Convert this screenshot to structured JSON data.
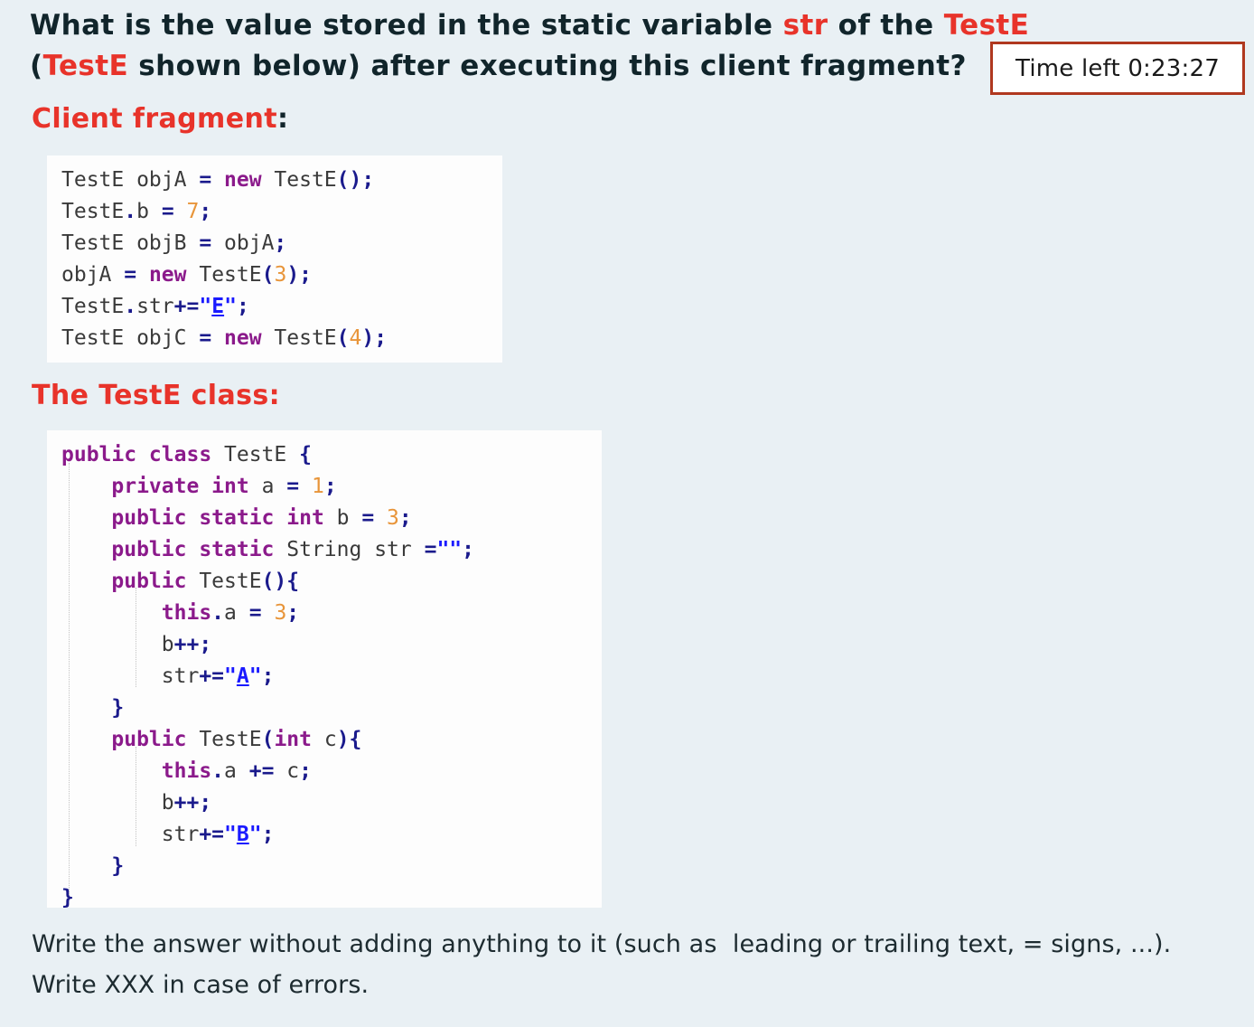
{
  "question": {
    "segments": [
      {
        "text": "What is the value stored in the static variable ",
        "accent": false
      },
      {
        "text": "str",
        "accent": true
      },
      {
        "text": " of the ",
        "accent": false
      },
      {
        "text": "TestE",
        "accent": true
      },
      {
        "text": " (",
        "accent": false
      },
      {
        "text": "TestE",
        "accent": true
      },
      {
        "text": " shown below) after executing this client fragment?",
        "accent": false
      }
    ],
    "plain_text": "What is the value stored in the static variable str of the TestE (TestE shown below) after executing this client fragment?"
  },
  "timer": {
    "label": "Time left 0:23:27",
    "border_color": "#b0381f",
    "background": "#ffffff"
  },
  "headings": {
    "client_fragment": "Client fragment",
    "client_fragment_punct": ":",
    "teste_class": "The TestE class:"
  },
  "colors": {
    "page_background": "#e9f0f4",
    "accent_red": "#e8332a",
    "question_text": "#11252b",
    "code_background": "#fdfdfd",
    "keyword": "#8b1a8b",
    "number": "#e8953a",
    "operator": "#1a1a8c",
    "string": "#1a1aff",
    "identifier": "#3a3a3a"
  },
  "client_code": {
    "lines": [
      [
        {
          "t": "TestE objA ",
          "c": "t-type"
        },
        {
          "t": "= ",
          "c": "t-op"
        },
        {
          "t": "new ",
          "c": "t-kw"
        },
        {
          "t": "TestE",
          "c": "t-type"
        },
        {
          "t": "();",
          "c": "t-op"
        }
      ],
      [
        {
          "t": "TestE",
          "c": "t-type"
        },
        {
          "t": ".",
          "c": "t-op"
        },
        {
          "t": "b ",
          "c": "t-id"
        },
        {
          "t": "= ",
          "c": "t-op"
        },
        {
          "t": "7",
          "c": "t-num"
        },
        {
          "t": ";",
          "c": "t-op"
        }
      ],
      [
        {
          "t": "TestE objB ",
          "c": "t-type"
        },
        {
          "t": "= ",
          "c": "t-op"
        },
        {
          "t": "objA",
          "c": "t-id"
        },
        {
          "t": ";",
          "c": "t-op"
        }
      ],
      [
        {
          "t": "objA ",
          "c": "t-id"
        },
        {
          "t": "= ",
          "c": "t-op"
        },
        {
          "t": "new ",
          "c": "t-kw"
        },
        {
          "t": "TestE",
          "c": "t-type"
        },
        {
          "t": "(",
          "c": "t-op"
        },
        {
          "t": "3",
          "c": "t-num"
        },
        {
          "t": ");",
          "c": "t-op"
        }
      ],
      [
        {
          "t": "TestE",
          "c": "t-type"
        },
        {
          "t": ".",
          "c": "t-op"
        },
        {
          "t": "str",
          "c": "t-id"
        },
        {
          "t": "+=",
          "c": "t-op"
        },
        {
          "t": "\"",
          "c": "t-quote"
        },
        {
          "t": "E",
          "c": "t-str"
        },
        {
          "t": "\"",
          "c": "t-quote"
        },
        {
          "t": ";",
          "c": "t-op"
        }
      ],
      [
        {
          "t": "TestE objC ",
          "c": "t-type"
        },
        {
          "t": "= ",
          "c": "t-op"
        },
        {
          "t": "new ",
          "c": "t-kw"
        },
        {
          "t": "TestE",
          "c": "t-type"
        },
        {
          "t": "(",
          "c": "t-op"
        },
        {
          "t": "4",
          "c": "t-num"
        },
        {
          "t": ");",
          "c": "t-op"
        }
      ]
    ],
    "plain_text": "TestE objA = new TestE();\nTestE.b = 7;\nTestE objB = objA;\nobjA = new TestE(3);\nTestE.str+=\"E\";\nTestE objC = new TestE(4);"
  },
  "class_code": {
    "lines": [
      [
        {
          "t": "public class ",
          "c": "t-kw"
        },
        {
          "t": "TestE ",
          "c": "t-type"
        },
        {
          "t": "{",
          "c": "t-op"
        }
      ],
      [
        {
          "t": "    ",
          "c": "t-id"
        },
        {
          "t": "private int ",
          "c": "t-kw"
        },
        {
          "t": "a ",
          "c": "t-id"
        },
        {
          "t": "= ",
          "c": "t-op"
        },
        {
          "t": "1",
          "c": "t-num"
        },
        {
          "t": ";",
          "c": "t-op"
        }
      ],
      [
        {
          "t": "    ",
          "c": "t-id"
        },
        {
          "t": "public static int ",
          "c": "t-kw"
        },
        {
          "t": "b ",
          "c": "t-id"
        },
        {
          "t": "= ",
          "c": "t-op"
        },
        {
          "t": "3",
          "c": "t-num"
        },
        {
          "t": ";",
          "c": "t-op"
        }
      ],
      [
        {
          "t": "    ",
          "c": "t-id"
        },
        {
          "t": "public static ",
          "c": "t-kw"
        },
        {
          "t": "String str ",
          "c": "t-type"
        },
        {
          "t": "=",
          "c": "t-op"
        },
        {
          "t": "\"\"",
          "c": "t-quote"
        },
        {
          "t": ";",
          "c": "t-op"
        }
      ],
      [
        {
          "t": "    ",
          "c": "t-id"
        },
        {
          "t": "public ",
          "c": "t-kw"
        },
        {
          "t": "TestE",
          "c": "t-type"
        },
        {
          "t": "(){",
          "c": "t-op"
        }
      ],
      [
        {
          "t": "        ",
          "c": "t-id"
        },
        {
          "t": "this",
          "c": "t-kw"
        },
        {
          "t": ".",
          "c": "t-op"
        },
        {
          "t": "a ",
          "c": "t-id"
        },
        {
          "t": "= ",
          "c": "t-op"
        },
        {
          "t": "3",
          "c": "t-num"
        },
        {
          "t": ";",
          "c": "t-op"
        }
      ],
      [
        {
          "t": "        ",
          "c": "t-id"
        },
        {
          "t": "b",
          "c": "t-id"
        },
        {
          "t": "++;",
          "c": "t-op"
        }
      ],
      [
        {
          "t": "        ",
          "c": "t-id"
        },
        {
          "t": "str",
          "c": "t-id"
        },
        {
          "t": "+=",
          "c": "t-op"
        },
        {
          "t": "\"",
          "c": "t-quote"
        },
        {
          "t": "A",
          "c": "t-str"
        },
        {
          "t": "\"",
          "c": "t-quote"
        },
        {
          "t": ";",
          "c": "t-op"
        }
      ],
      [
        {
          "t": "    ",
          "c": "t-id"
        },
        {
          "t": "}",
          "c": "t-op"
        }
      ],
      [
        {
          "t": "    ",
          "c": "t-id"
        },
        {
          "t": "public ",
          "c": "t-kw"
        },
        {
          "t": "TestE",
          "c": "t-type"
        },
        {
          "t": "(",
          "c": "t-op"
        },
        {
          "t": "int ",
          "c": "t-kw"
        },
        {
          "t": "c",
          "c": "t-id"
        },
        {
          "t": "){",
          "c": "t-op"
        }
      ],
      [
        {
          "t": "        ",
          "c": "t-id"
        },
        {
          "t": "this",
          "c": "t-kw"
        },
        {
          "t": ".",
          "c": "t-op"
        },
        {
          "t": "a ",
          "c": "t-id"
        },
        {
          "t": "+= ",
          "c": "t-op"
        },
        {
          "t": "c",
          "c": "t-id"
        },
        {
          "t": ";",
          "c": "t-op"
        }
      ],
      [
        {
          "t": "        ",
          "c": "t-id"
        },
        {
          "t": "b",
          "c": "t-id"
        },
        {
          "t": "++;",
          "c": "t-op"
        }
      ],
      [
        {
          "t": "        ",
          "c": "t-id"
        },
        {
          "t": "str",
          "c": "t-id"
        },
        {
          "t": "+=",
          "c": "t-op"
        },
        {
          "t": "\"",
          "c": "t-quote"
        },
        {
          "t": "B",
          "c": "t-str"
        },
        {
          "t": "\"",
          "c": "t-quote"
        },
        {
          "t": ";",
          "c": "t-op"
        }
      ],
      [
        {
          "t": "    ",
          "c": "t-id"
        },
        {
          "t": "}",
          "c": "t-op"
        }
      ],
      [
        {
          "t": "}",
          "c": "t-op"
        }
      ]
    ],
    "plain_text": "public class TestE {\n    private int a = 1;\n    public static int b = 3;\n    public static String str =\"\";\n    public TestE(){\n        this.a = 3;\n        b++;\n        str+=\"A\";\n    }\n    public TestE(int c){\n        this.a += c;\n        b++;\n        str+=\"B\";\n    }\n}"
  },
  "footer": {
    "line1": "Write the answer without adding anything to it (such as  leading or trailing text, = signs, ...).",
    "line2": "Write XXX in case of errors."
  }
}
